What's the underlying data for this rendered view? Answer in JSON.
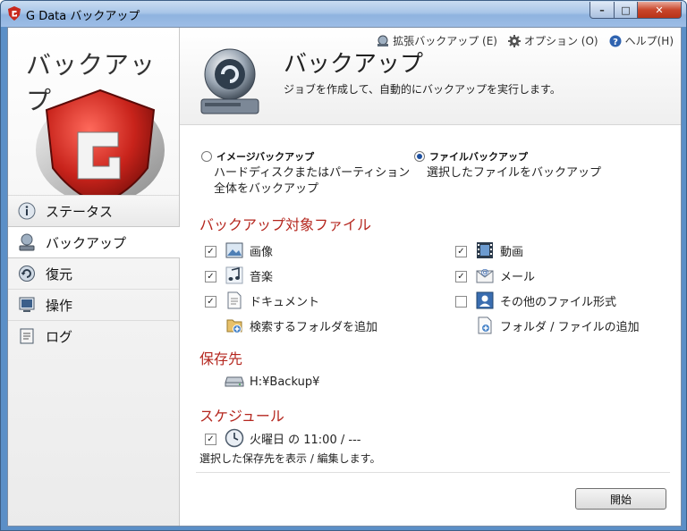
{
  "window": {
    "title": "G Data バックアップ",
    "min": "–",
    "max": "□",
    "close": "✕"
  },
  "sidebar": {
    "brand": "バックアップ",
    "items": [
      {
        "label": "ステータス",
        "icon": "info-icon"
      },
      {
        "label": "バックアップ",
        "icon": "backup-drive-icon"
      },
      {
        "label": "復元",
        "icon": "restore-icon"
      },
      {
        "label": "操作",
        "icon": "operation-icon"
      },
      {
        "label": "ログ",
        "icon": "log-icon"
      }
    ],
    "active_index": 1
  },
  "toplinks": [
    {
      "label": "拡張バックアップ (E)",
      "icon": "extended-backup-icon"
    },
    {
      "label": "オプション (O)",
      "icon": "gear-icon"
    },
    {
      "label": "ヘルプ(H)",
      "icon": "help-icon"
    }
  ],
  "header": {
    "title": "バックアップ",
    "subtitle": "ジョブを作成して、自動的にバックアップを実行します。"
  },
  "mode": {
    "image": {
      "label": "イメージバックアップ",
      "desc1": "ハードディスクまたはパーティション",
      "desc2": "全体をバックアップ",
      "selected": false
    },
    "file": {
      "label": "ファイルバックアップ",
      "desc": "選択したファイルをバックアップ",
      "selected": true
    }
  },
  "targets": {
    "heading": "バックアップ対象ファイル",
    "left": [
      {
        "label": "画像",
        "checked": true,
        "icon": "picture-icon"
      },
      {
        "label": "音楽",
        "checked": true,
        "icon": "music-icon"
      },
      {
        "label": "ドキュメント",
        "checked": true,
        "icon": "document-icon"
      }
    ],
    "right": [
      {
        "label": "動画",
        "checked": true,
        "icon": "video-icon"
      },
      {
        "label": "メール",
        "checked": true,
        "icon": "mail-icon"
      },
      {
        "label": "その他のファイル形式",
        "checked": false,
        "icon": "other-files-icon"
      }
    ],
    "add_search_folder": "検索するフォルダを追加",
    "add_folder_file": "フォルダ / ファイルの追加"
  },
  "destination": {
    "heading": "保存先",
    "path": "H:¥Backup¥"
  },
  "schedule": {
    "heading": "スケジュール",
    "value": "火曜日 の 11:00 / ---",
    "checked": true,
    "note": "選択した保存先を表示 / 編集します。"
  },
  "start_button": "開始",
  "colors": {
    "section_red": "#b5271f",
    "title_blue": "#9dbde6",
    "accent": "#1d4f9e"
  }
}
